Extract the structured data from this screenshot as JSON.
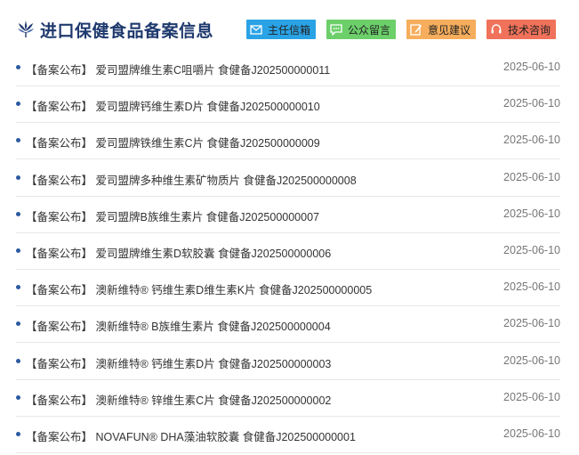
{
  "header": {
    "title": "进口保健食品备案信息",
    "logo_icon": "wheat-emblem-icon",
    "buttons": [
      {
        "label": "主任信箱",
        "icon": "mail-icon",
        "color": "#2aa3e6"
      },
      {
        "label": "公众留言",
        "icon": "message-icon",
        "color": "#6ccf6a"
      },
      {
        "label": "意见建议",
        "icon": "pencil-note-icon",
        "color": "#f6ad5c"
      },
      {
        "label": "技术咨询",
        "icon": "headset-icon",
        "color": "#f0725a"
      }
    ]
  },
  "list": {
    "items": [
      {
        "prefix": "【备案公布】",
        "title": "爱司盟牌维生素C咀嚼片 食健备J202500000011",
        "date": "2025-06-10"
      },
      {
        "prefix": "【备案公布】",
        "title": "爱司盟牌钙维生素D片 食健备J202500000010",
        "date": "2025-06-10"
      },
      {
        "prefix": "【备案公布】",
        "title": "爱司盟牌铁维生素C片 食健备J202500000009",
        "date": "2025-06-10"
      },
      {
        "prefix": "【备案公布】",
        "title": "爱司盟牌多种维生素矿物质片 食健备J202500000008",
        "date": "2025-06-10"
      },
      {
        "prefix": "【备案公布】",
        "title": "爱司盟牌B族维生素片 食健备J202500000007",
        "date": "2025-06-10"
      },
      {
        "prefix": "【备案公布】",
        "title": "爱司盟牌维生素D软胶囊 食健备J202500000006",
        "date": "2025-06-10"
      },
      {
        "prefix": "【备案公布】",
        "title": "澳新维特® 钙维生素D维生素K片 食健备J202500000005",
        "date": "2025-06-10"
      },
      {
        "prefix": "【备案公布】",
        "title": "澳新维特® B族维生素片 食健备J202500000004",
        "date": "2025-06-10"
      },
      {
        "prefix": "【备案公布】",
        "title": "澳新维特® 钙维生素D片 食健备J202500000003",
        "date": "2025-06-10"
      },
      {
        "prefix": "【备案公布】",
        "title": "澳新维特® 锌维生素C片 食健备J202500000002",
        "date": "2025-06-10"
      },
      {
        "prefix": "【备案公布】",
        "title": "NOVAFUN® DHA藻油软胶囊 食健备J202500000001",
        "date": "2025-06-10"
      }
    ]
  }
}
